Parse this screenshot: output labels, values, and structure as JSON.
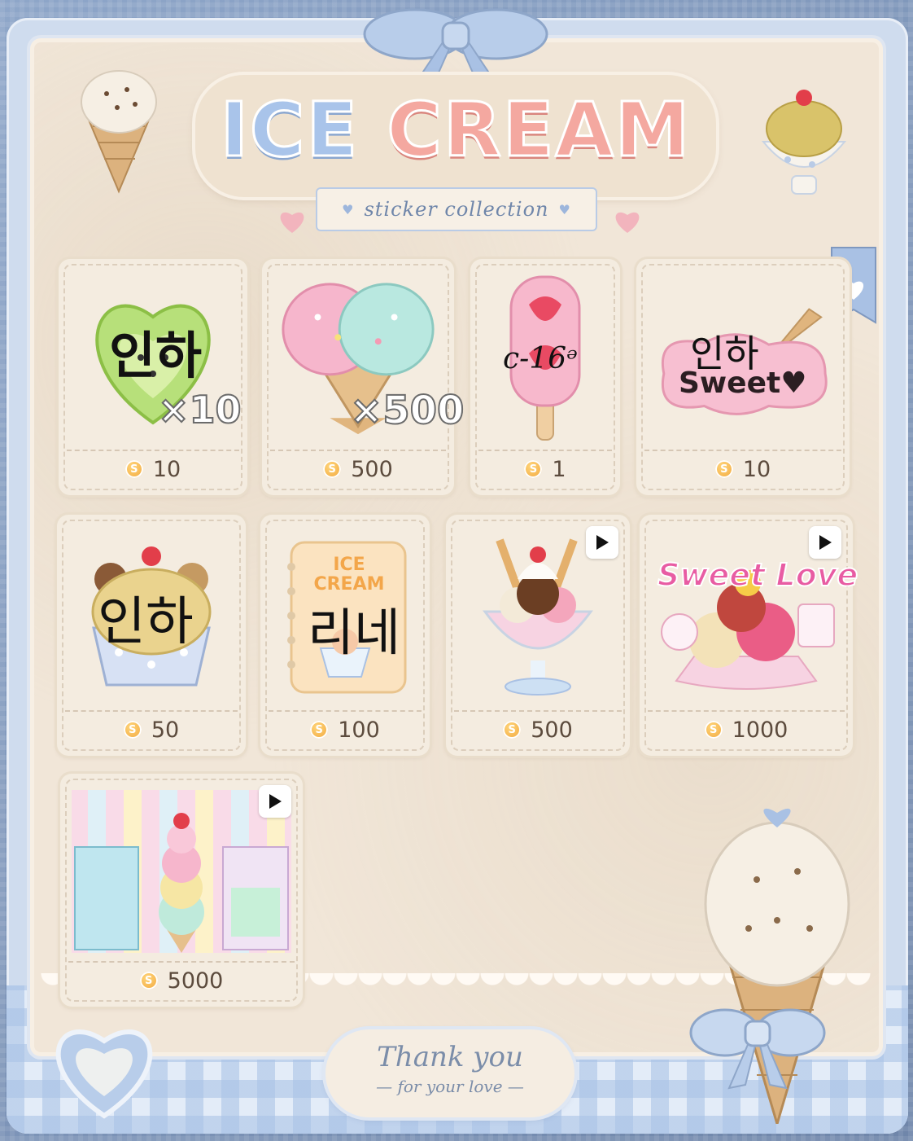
{
  "header": {
    "title_part1": "ICE",
    "title_part2": "CREAM",
    "subtitle": "sticker collection"
  },
  "coin_symbol": "S",
  "items": [
    {
      "price": "10",
      "overlay": "인하",
      "qty": "×10",
      "has_video": false
    },
    {
      "price": "500",
      "overlay": "",
      "qty": "×500",
      "has_video": false
    },
    {
      "price": "1",
      "overlay": "c-16ᵊ",
      "qty": "",
      "has_video": false
    },
    {
      "price": "10",
      "overlay": "인하",
      "sticker_text": "Sweet♥",
      "qty": "",
      "has_video": false
    },
    {
      "price": "50",
      "overlay": "인하",
      "qty": "",
      "has_video": false
    },
    {
      "price": "100",
      "overlay": "리네",
      "sticker_text": "ICE CREAM",
      "qty": "",
      "has_video": false
    },
    {
      "price": "500",
      "overlay": "",
      "qty": "",
      "has_video": true
    },
    {
      "price": "1000",
      "overlay": "",
      "sticker_text": "Sweet Love",
      "qty": "",
      "has_video": true
    },
    {
      "price": "5000",
      "overlay": "",
      "qty": "",
      "has_video": true
    }
  ],
  "footer": {
    "thanks_line1": "Thank you",
    "thanks_line2": "— for your love —"
  },
  "colors": {
    "frame_blue": "#8ea6c9",
    "paper": "#f1e6d8",
    "coin": "#f1a53a",
    "accent_pink": "#f4a8a0"
  }
}
